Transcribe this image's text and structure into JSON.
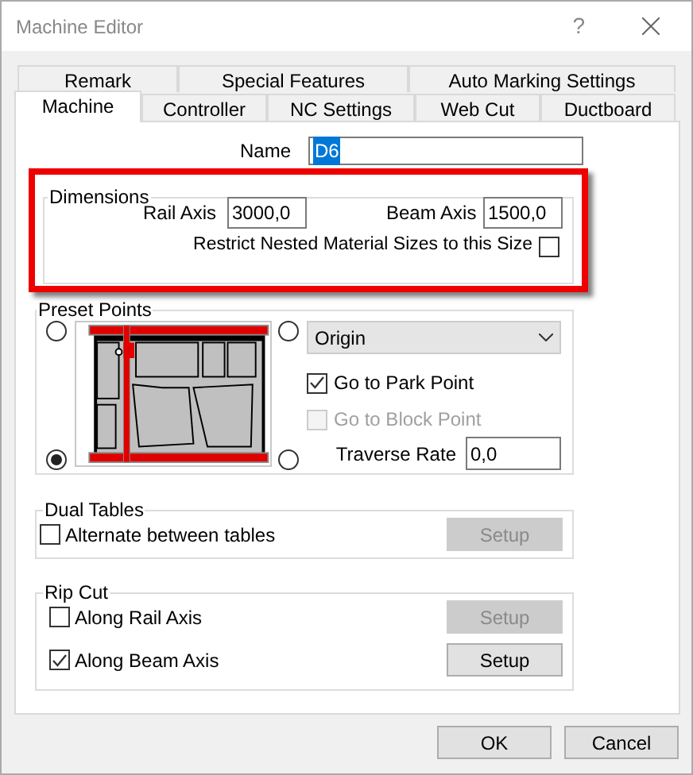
{
  "window": {
    "title": "Machine Editor",
    "help": "?"
  },
  "tabs_back_row": [
    {
      "label": "Remark",
      "selected": false
    },
    {
      "label": "Special Features",
      "selected": false
    },
    {
      "label": "Auto Marking Settings",
      "selected": false
    }
  ],
  "tabs_front_row": [
    {
      "label": "Machine",
      "selected": true
    },
    {
      "label": "Controller",
      "selected": false
    },
    {
      "label": "NC Settings",
      "selected": false
    },
    {
      "label": "Web Cut",
      "selected": false
    },
    {
      "label": "Ductboard",
      "selected": false
    }
  ],
  "name": {
    "label": "Name",
    "value": "D6",
    "text_selected": true
  },
  "dimensions": {
    "title": "Dimensions",
    "highlighted": true,
    "rail_axis": {
      "label": "Rail Axis",
      "value": "3000,0"
    },
    "beam_axis": {
      "label": "Beam Axis",
      "value": "1500,0"
    },
    "restrict": {
      "label": "Restrict Nested Material Sizes to this Size",
      "checked": false
    }
  },
  "preset_points": {
    "title": "Preset Points",
    "corners": [
      {
        "selected": false
      },
      {
        "selected": false
      },
      {
        "selected": true
      },
      {
        "selected": false
      }
    ],
    "dropdown": {
      "value": "Origin"
    },
    "options": [
      {
        "label": "Go to Park Point",
        "checked": true,
        "disabled": false
      },
      {
        "label": "Go to Block Point",
        "checked": false,
        "disabled": true
      }
    ],
    "traverse_rate": {
      "label": "Traverse Rate",
      "value": "0,0"
    }
  },
  "dual_tables": {
    "title": "Dual Tables",
    "option": {
      "label": "Alternate between tables",
      "checked": false
    },
    "setup": {
      "label": "Setup",
      "disabled": true
    }
  },
  "rip_cut": {
    "title": "Rip Cut",
    "options": [
      {
        "label": "Along Rail Axis",
        "checked": false,
        "setup": {
          "label": "Setup",
          "disabled": true
        }
      },
      {
        "label": "Along Beam Axis",
        "checked": true,
        "setup": {
          "label": "Setup",
          "disabled": false
        }
      }
    ]
  },
  "buttons": [
    {
      "label": "OK"
    },
    {
      "label": "Cancel"
    }
  ]
}
